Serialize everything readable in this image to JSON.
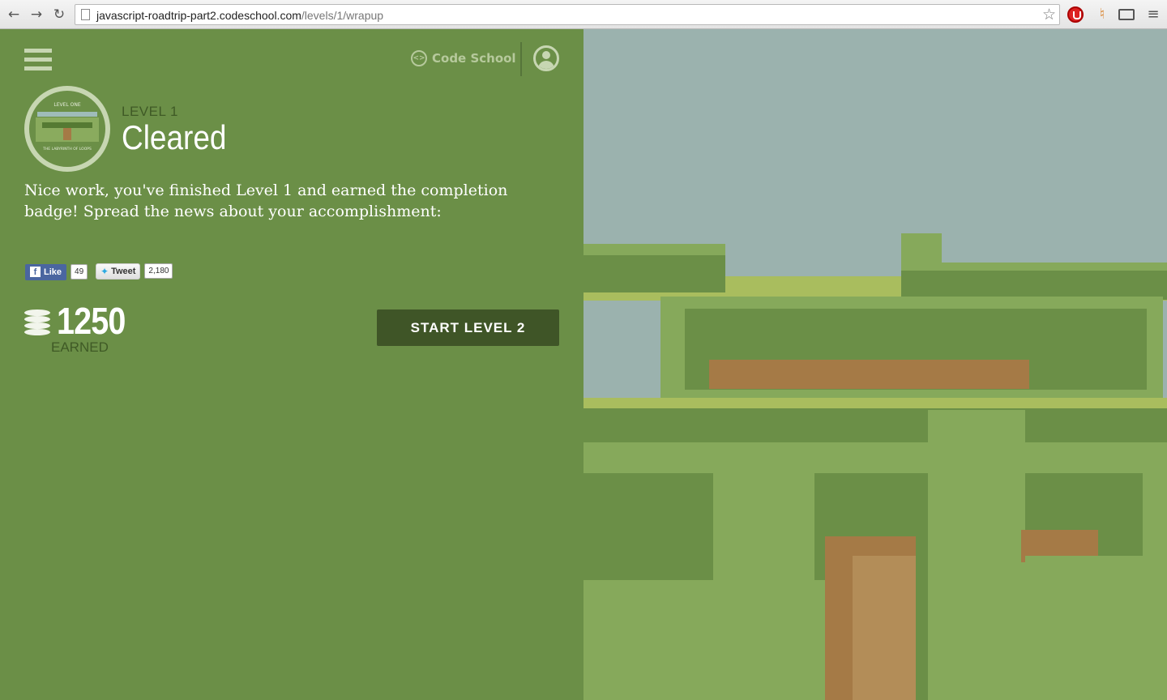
{
  "browser": {
    "url_host": "javascript-roadtrip-part2.codeschool.com",
    "url_path": "/levels/1/wrapup",
    "icons": [
      "back-arrow-icon",
      "forward-arrow-icon",
      "reload-icon",
      "page-icon",
      "bookmark-star-icon",
      "extension-icon",
      "tool-extension-icon",
      "cast-icon",
      "menu-icon"
    ]
  },
  "header": {
    "brand": "Code School",
    "brand_icon": "code-brackets-icon",
    "user_icon": "user-icon"
  },
  "badge": {
    "top_text": "LEVEL ONE",
    "bottom_text": "THE LABYRINTH OF LOOPS"
  },
  "level": {
    "label": "LEVEL 1",
    "status": "Cleared"
  },
  "message": "Nice work, you've finished Level 1 and earned the completion badge! Spread the news about your accomplishment:",
  "social": {
    "facebook_label": "Like",
    "facebook_count": "49",
    "twitter_label": "Tweet",
    "twitter_count": "2,180"
  },
  "points": {
    "value": "1250",
    "label": "EARNED"
  },
  "actions": {
    "start_next": "START LEVEL 2"
  },
  "colors": {
    "panel_bg": "#6b8f47",
    "button_bg": "#3f5527",
    "muted_text": "#3f5a26",
    "sky": "#9bb2ae",
    "hedge_light": "#86a95b",
    "hedge_dark": "#6b8f47",
    "dirt": "#a57a46"
  }
}
